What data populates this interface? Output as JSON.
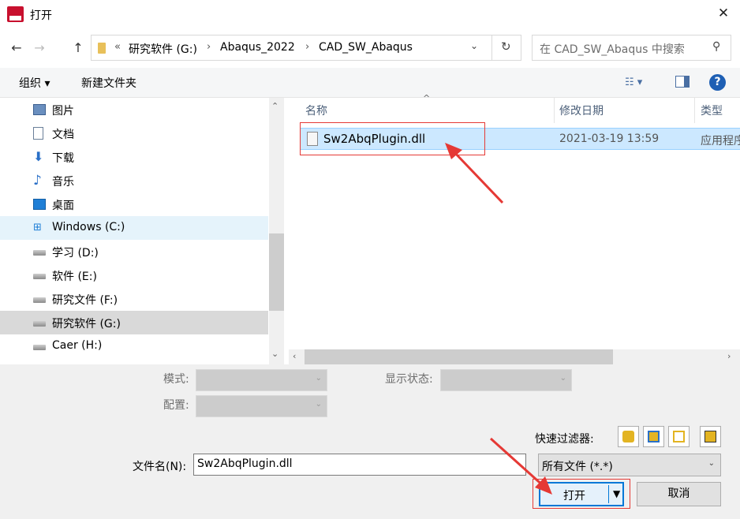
{
  "window": {
    "title": "打开",
    "close_icon": "close-icon"
  },
  "nav": {
    "back_icon": "arrow-left-icon",
    "forward_icon": "arrow-right-icon",
    "up_icon": "arrow-up-icon",
    "address": {
      "overflow": "«",
      "crumbs": [
        "研究软件 (G:)",
        "Abaqus_2022",
        "CAD_SW_Abaqus"
      ],
      "separator": "›"
    },
    "search_placeholder": "在 CAD_SW_Abaqus 中搜索"
  },
  "toolbar": {
    "organize": "组织 ▾",
    "new_folder": "新建文件夹",
    "help": "?"
  },
  "sidebar": {
    "items": [
      {
        "label": "图片",
        "icon": "pictures-icon"
      },
      {
        "label": "文档",
        "icon": "documents-icon"
      },
      {
        "label": "下载",
        "icon": "download-icon"
      },
      {
        "label": "音乐",
        "icon": "music-icon"
      },
      {
        "label": "桌面",
        "icon": "desktop-icon"
      },
      {
        "label": "Windows (C:)",
        "icon": "windows-drive-icon"
      },
      {
        "label": "学习 (D:)",
        "icon": "drive-icon"
      },
      {
        "label": "软件 (E:)",
        "icon": "drive-icon"
      },
      {
        "label": "研究文件 (F:)",
        "icon": "drive-icon"
      },
      {
        "label": "研究软件 (G:)",
        "icon": "drive-icon"
      },
      {
        "label": "Caer (H:)",
        "icon": "drive-icon"
      }
    ]
  },
  "files": {
    "columns": {
      "name": "名称",
      "modified": "修改日期",
      "type": "类型"
    },
    "sort_indicator": "^",
    "rows": [
      {
        "name": "Sw2AbqPlugin.dll",
        "modified": "2021-03-19 13:59",
        "type": "应用程序扩展"
      }
    ]
  },
  "options": {
    "mode_label": "模式:",
    "display_state_label": "显示状态:",
    "config_label": "配置:",
    "quick_filter_label": "快速过滤器:"
  },
  "filename": {
    "label": "文件名(N):",
    "value": "Sw2AbqPlugin.dll",
    "filter_value": "所有文件 (*.*)"
  },
  "buttons": {
    "open": "打开",
    "cancel": "取消"
  },
  "colors": {
    "highlight": "#e53935",
    "accent": "#0078d7",
    "selection": "#cce8ff"
  }
}
